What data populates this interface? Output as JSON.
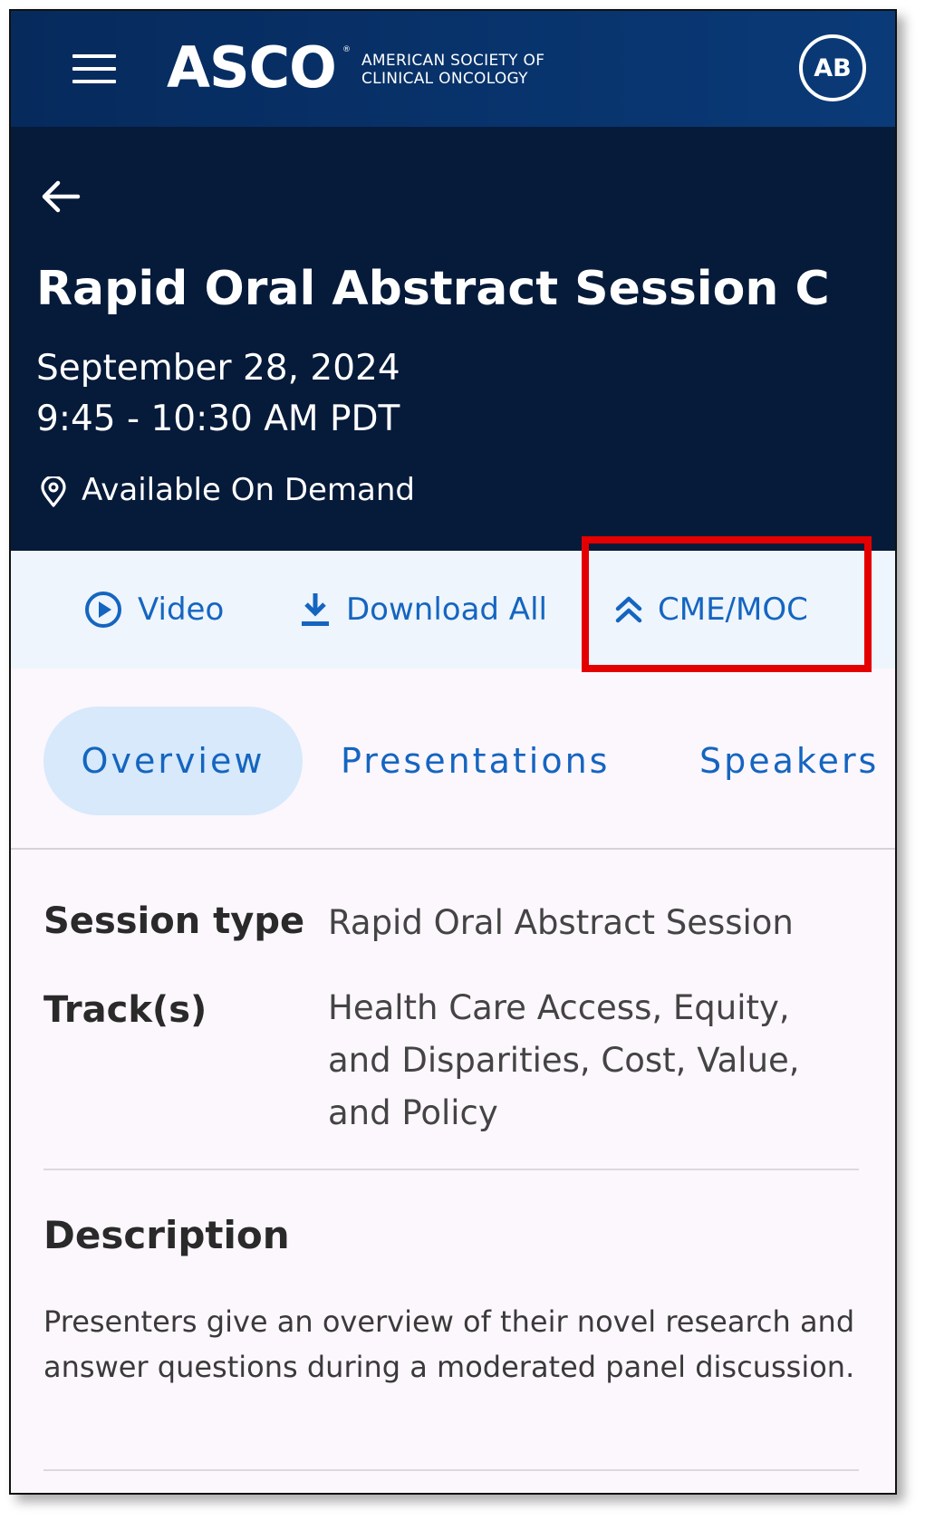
{
  "header": {
    "logo_text": "ASCO",
    "logo_reg": "®",
    "logo_subtitle_line1": "AMERICAN SOCIETY OF",
    "logo_subtitle_line2": "CLINICAL ONCOLOGY",
    "avatar_initials": "AB",
    "menu_icon": "hamburger-menu-icon"
  },
  "session": {
    "title": "Rapid Oral Abstract Session C",
    "date": "September 28, 2024",
    "time": "9:45 - 10:30 AM PDT",
    "location": "Available On Demand",
    "location_icon": "location-pin-icon",
    "back_icon": "back-arrow-icon"
  },
  "actions": [
    {
      "label": "Video",
      "icon": "play-circle-icon"
    },
    {
      "label": "Download All",
      "icon": "download-icon"
    },
    {
      "label": "CME/MOC",
      "icon": "double-chevron-up-icon"
    }
  ],
  "tabs": [
    {
      "label": "Overview",
      "active": true
    },
    {
      "label": "Presentations",
      "active": false
    },
    {
      "label": "Speakers",
      "active": false
    }
  ],
  "overview": {
    "session_type_label": "Session type",
    "session_type_value": "Rapid Oral Abstract Session",
    "tracks_label": "Track(s)",
    "tracks_value": "Health Care Access, Equity, and Disparities, Cost, Value, and Policy",
    "description_title": "Description",
    "description_text": "Presenters give an overview of their novel research and answer questions during a moderated panel discussion."
  },
  "colors": {
    "header_bg": "#0a3a78",
    "hero_bg": "#061a3a",
    "accent": "#1565c0",
    "highlight": "#e40000",
    "actions_bg": "#eef5fd",
    "active_tab_bg": "#d7e9fb",
    "page_bg": "#fcf7fd"
  }
}
